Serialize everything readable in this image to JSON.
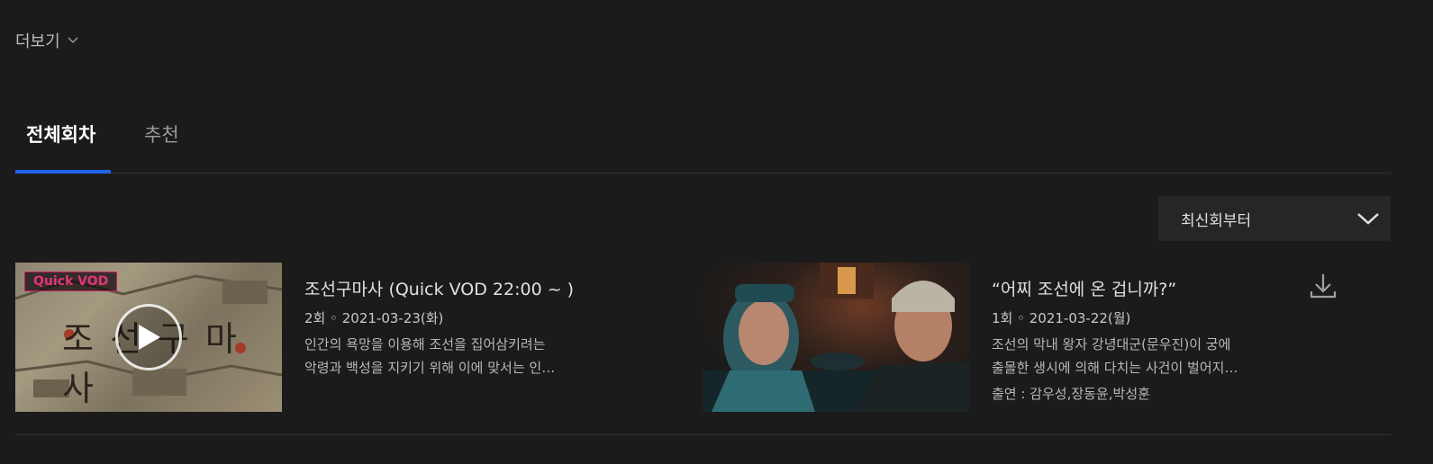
{
  "more": {
    "label": "더보기"
  },
  "tabs": [
    {
      "label": "전체회차",
      "active": true
    },
    {
      "label": "추천",
      "active": false
    }
  ],
  "sort": {
    "selected": "최신회부터"
  },
  "episodes": [
    {
      "badge": "Quick VOD",
      "thumb_text": "조선구마사",
      "title": "조선구마사 (Quick VOD 22:00 ~ )",
      "meta": "2회 ◦ 2021-03-23(화)",
      "desc_line1": "인간의 욕망을 이용해 조선을 집어삼키려는",
      "desc_line2": "악령과 백성을 지키기 위해 이에 맞서는 인…"
    },
    {
      "title": "“어찌 조선에 온 겁니까?”",
      "meta": "1회 ◦ 2021-03-22(월)",
      "desc_line1": "조선의 막내 왕자 강녕대군(문우진)이 궁에",
      "desc_line2": "출몰한 생시에 의해 다치는 사건이 벌어지…",
      "cast": "출연 : 감우성,장동윤,박성훈"
    }
  ],
  "colors": {
    "accent": "#1f63e8",
    "badge": "#c71e65",
    "background": "#1b1b1b"
  }
}
